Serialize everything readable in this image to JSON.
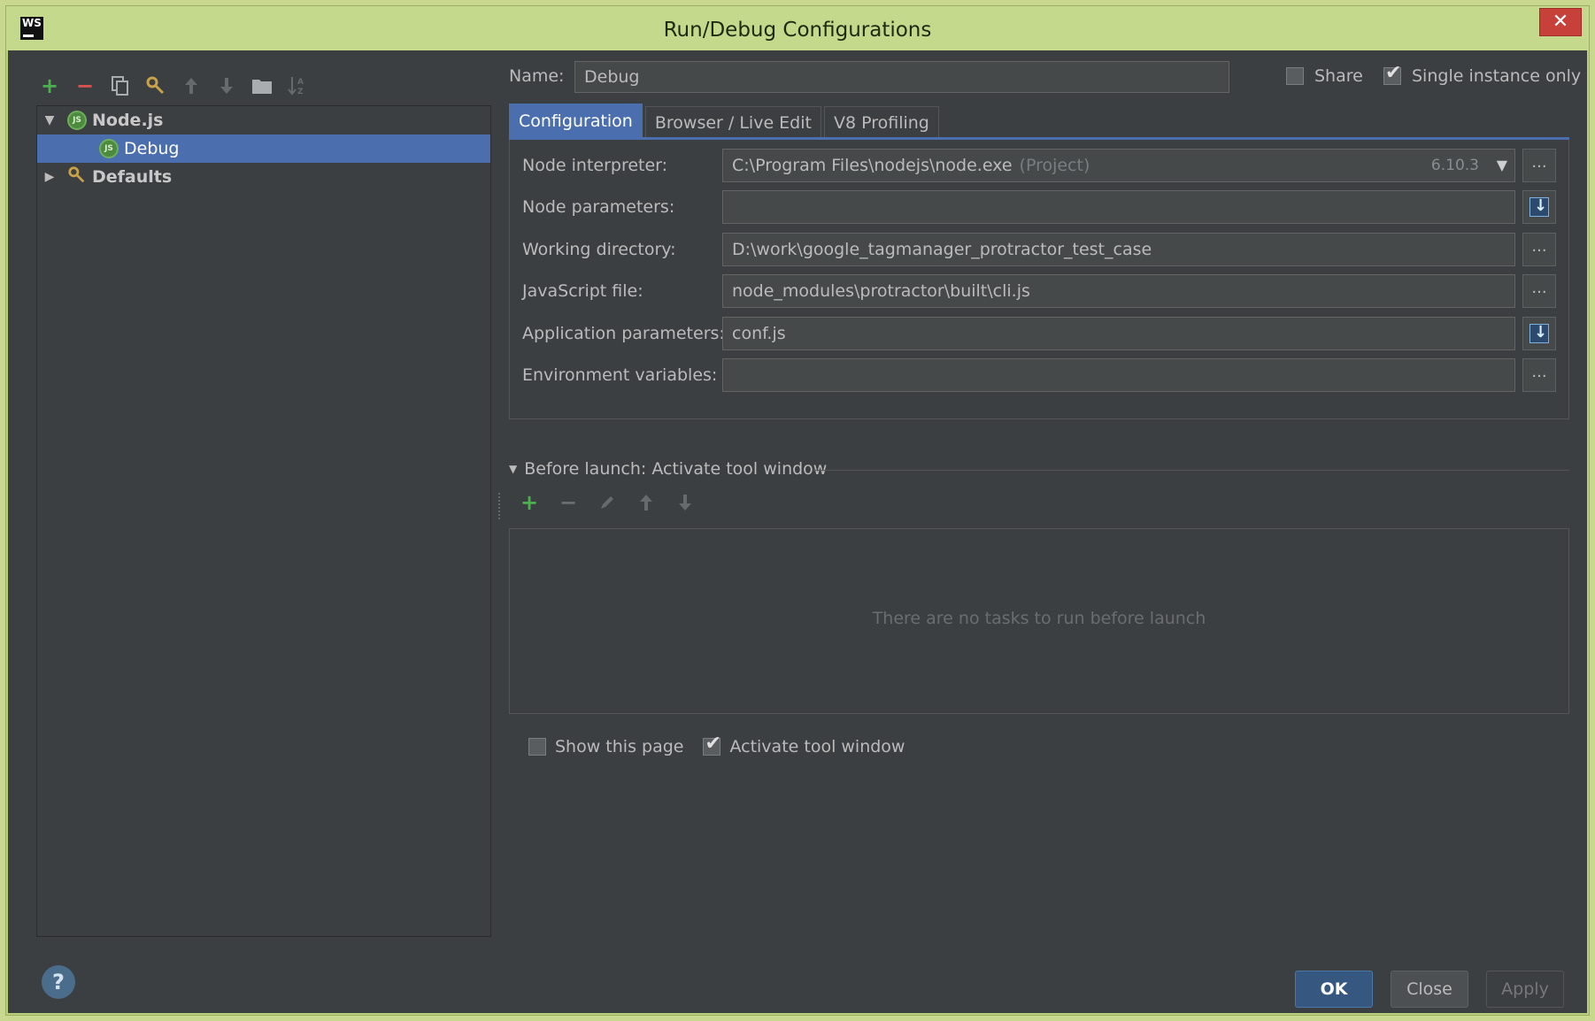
{
  "window": {
    "title": "Run/Debug Configurations",
    "app_icon": "WS",
    "close_glyph": "✕"
  },
  "toolbar": {
    "add": "+",
    "remove": "−"
  },
  "tree": {
    "nodejs_label": "Node.js",
    "debug_label": "Debug",
    "defaults_label": "Defaults"
  },
  "name": {
    "label": "Name:",
    "value": "Debug"
  },
  "share": {
    "label": "Share",
    "checked": false
  },
  "single_instance": {
    "label": "Single instance only",
    "checked": true
  },
  "tabs": [
    {
      "label": "Configuration",
      "active": true
    },
    {
      "label": "Browser / Live Edit",
      "active": false
    },
    {
      "label": "V8 Profiling",
      "active": false
    }
  ],
  "form": {
    "node_interpreter": {
      "label": "Node interpreter:",
      "value": "C:\\Program Files\\nodejs\\node.exe",
      "hint": "(Project)",
      "version": "6.10.3"
    },
    "node_parameters": {
      "label": "Node parameters:",
      "value": ""
    },
    "working_directory": {
      "label": "Working directory:",
      "value": "D:\\work\\google_tagmanager_protractor_test_case"
    },
    "javascript_file": {
      "label": "JavaScript file:",
      "value": "node_modules\\protractor\\built\\cli.js"
    },
    "application_parameters": {
      "label": "Application parameters:",
      "value": "conf.js"
    },
    "environment_variables": {
      "label": "Environment variables:",
      "value": ""
    },
    "browse_glyph": "..."
  },
  "before_launch": {
    "header": "Before launch: Activate tool window",
    "empty": "There are no tasks to run before launch"
  },
  "bottom": {
    "show_page": {
      "label": "Show this page",
      "checked": false
    },
    "activate_tool": {
      "label": "Activate tool window",
      "checked": true
    }
  },
  "buttons": {
    "ok": "OK",
    "close": "Close",
    "apply": "Apply",
    "help": "?"
  },
  "colors": {
    "accent": "#4b6eaf",
    "background": "#3c3f41",
    "title_bar": "#c4d98c",
    "close": "#c7403a"
  }
}
